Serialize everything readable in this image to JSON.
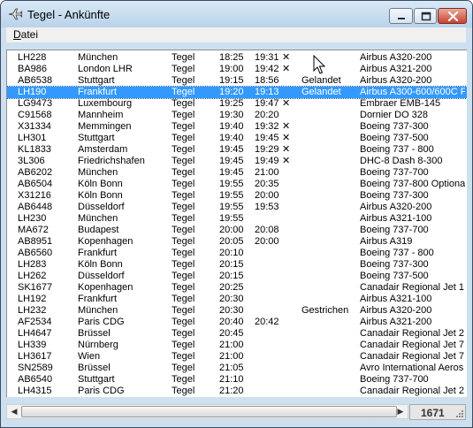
{
  "window": {
    "title": "Tegel - Ankünfte",
    "accent": "#3399ff"
  },
  "menu": {
    "file_prefix": "D",
    "file_rest": "atei"
  },
  "flights": [
    {
      "flight": "LH228",
      "from": "München",
      "airport": "Tegel",
      "scheduled": "18:25",
      "actual": "19:31",
      "mark": "✕",
      "status": "",
      "aircraft": "Airbus A320-200"
    },
    {
      "flight": "BA986",
      "from": "London LHR",
      "airport": "Tegel",
      "scheduled": "19:00",
      "actual": "19:42",
      "mark": "✕",
      "status": "",
      "aircraft": "Airbus A321-200"
    },
    {
      "flight": "AB6538",
      "from": "Stuttgart",
      "airport": "Tegel",
      "scheduled": "19:15",
      "actual": "18:56",
      "mark": "",
      "status": "Gelandet",
      "aircraft": "Airbus A320-200"
    },
    {
      "flight": "LH190",
      "from": "Frankfurt",
      "airport": "Tegel",
      "scheduled": "19:20",
      "actual": "19:13",
      "mark": "",
      "status": "Gelandet",
      "aircraft": "Airbus A300-600/600C F"
    },
    {
      "flight": "LG9473",
      "from": "Luxembourg",
      "airport": "Tegel",
      "scheduled": "19:25",
      "actual": "19:47",
      "mark": "✕",
      "status": "",
      "aircraft": "Embraer EMB-145"
    },
    {
      "flight": "C91568",
      "from": "Mannheim",
      "airport": "Tegel",
      "scheduled": "19:30",
      "actual": "20:20",
      "mark": "",
      "status": "",
      "aircraft": "Dornier DO 328"
    },
    {
      "flight": "X31334",
      "from": "Memmingen",
      "airport": "Tegel",
      "scheduled": "19:40",
      "actual": "19:32",
      "mark": "✕",
      "status": "",
      "aircraft": "Boeing 737-300"
    },
    {
      "flight": "LH301",
      "from": "Stuttgart",
      "airport": "Tegel",
      "scheduled": "19:40",
      "actual": "19:45",
      "mark": "✕",
      "status": "",
      "aircraft": "Boeing 737-500"
    },
    {
      "flight": "KL1833",
      "from": "Amsterdam",
      "airport": "Tegel",
      "scheduled": "19:45",
      "actual": "19:29",
      "mark": "✕",
      "status": "",
      "aircraft": "Boeing 737 - 800"
    },
    {
      "flight": "3L306",
      "from": "Friedrichshafen",
      "airport": "Tegel",
      "scheduled": "19:45",
      "actual": "19:49",
      "mark": "✕",
      "status": "",
      "aircraft": "DHC-8 Dash 8-300"
    },
    {
      "flight": "AB6202",
      "from": "München",
      "airport": "Tegel",
      "scheduled": "19:45",
      "actual": "21:00",
      "mark": "",
      "status": "",
      "aircraft": "Boeing 737-700"
    },
    {
      "flight": "AB6504",
      "from": "Köln Bonn",
      "airport": "Tegel",
      "scheduled": "19:55",
      "actual": "20:35",
      "mark": "",
      "status": "",
      "aircraft": "Boeing 737-800 Optiona"
    },
    {
      "flight": "X31216",
      "from": "Köln Bonn",
      "airport": "Tegel",
      "scheduled": "19:55",
      "actual": "20:00",
      "mark": "",
      "status": "",
      "aircraft": "Boeing 737-300"
    },
    {
      "flight": "AB6448",
      "from": "Düsseldorf",
      "airport": "Tegel",
      "scheduled": "19:55",
      "actual": "19:53",
      "mark": "",
      "status": "",
      "aircraft": "Airbus A320-200"
    },
    {
      "flight": "LH230",
      "from": "München",
      "airport": "Tegel",
      "scheduled": "19:55",
      "actual": "",
      "mark": "",
      "status": "",
      "aircraft": "Airbus A321-100"
    },
    {
      "flight": "MA672",
      "from": "Budapest",
      "airport": "Tegel",
      "scheduled": "20:00",
      "actual": "20:08",
      "mark": "",
      "status": "",
      "aircraft": "Boeing 737-700"
    },
    {
      "flight": "AB8951",
      "from": "Kopenhagen",
      "airport": "Tegel",
      "scheduled": "20:05",
      "actual": "20:00",
      "mark": "",
      "status": "",
      "aircraft": "Airbus A319"
    },
    {
      "flight": "AB6560",
      "from": "Frankfurt",
      "airport": "Tegel",
      "scheduled": "20:10",
      "actual": "",
      "mark": "",
      "status": "",
      "aircraft": "Boeing 737 - 800"
    },
    {
      "flight": "LH283",
      "from": "Köln Bonn",
      "airport": "Tegel",
      "scheduled": "20:15",
      "actual": "",
      "mark": "",
      "status": "",
      "aircraft": "Boeing 737-300"
    },
    {
      "flight": "LH262",
      "from": "Düsseldorf",
      "airport": "Tegel",
      "scheduled": "20:15",
      "actual": "",
      "mark": "",
      "status": "",
      "aircraft": "Boeing 737-500"
    },
    {
      "flight": "SK1677",
      "from": "Kopenhagen",
      "airport": "Tegel",
      "scheduled": "20:25",
      "actual": "",
      "mark": "",
      "status": "",
      "aircraft": "Canadair Regional Jet 1"
    },
    {
      "flight": "LH192",
      "from": "Frankfurt",
      "airport": "Tegel",
      "scheduled": "20:30",
      "actual": "",
      "mark": "",
      "status": "",
      "aircraft": "Airbus A321-100"
    },
    {
      "flight": "LH232",
      "from": "München",
      "airport": "Tegel",
      "scheduled": "20:30",
      "actual": "",
      "mark": "",
      "status": "Gestrichen",
      "aircraft": "Airbus A320-200"
    },
    {
      "flight": "AF2534",
      "from": "Paris CDG",
      "airport": "Tegel",
      "scheduled": "20:40",
      "actual": "20:42",
      "mark": "",
      "status": "",
      "aircraft": "Airbus A321-200"
    },
    {
      "flight": "LH4647",
      "from": "Brüssel",
      "airport": "Tegel",
      "scheduled": "20:45",
      "actual": "",
      "mark": "",
      "status": "",
      "aircraft": "Canadair Regional Jet 2"
    },
    {
      "flight": "LH339",
      "from": "Nürnberg",
      "airport": "Tegel",
      "scheduled": "21:00",
      "actual": "",
      "mark": "",
      "status": "",
      "aircraft": "Canadair Regional Jet 7"
    },
    {
      "flight": "LH3617",
      "from": "Wien",
      "airport": "Tegel",
      "scheduled": "21:00",
      "actual": "",
      "mark": "",
      "status": "",
      "aircraft": "Canadair Regional Jet 7"
    },
    {
      "flight": "SN2589",
      "from": "Brüssel",
      "airport": "Tegel",
      "scheduled": "21:05",
      "actual": "",
      "mark": "",
      "status": "",
      "aircraft": "Avro International Aeros"
    },
    {
      "flight": "AB6540",
      "from": "Stuttgart",
      "airport": "Tegel",
      "scheduled": "21:10",
      "actual": "",
      "mark": "",
      "status": "",
      "aircraft": "Boeing 737-700"
    },
    {
      "flight": "LH4315",
      "from": "Paris CDG",
      "airport": "Tegel",
      "scheduled": "21:20",
      "actual": "",
      "mark": "",
      "status": "",
      "aircraft": "Canadair Regional Jet 2"
    }
  ],
  "selected_row": 3,
  "status": {
    "count": "1671"
  },
  "icons": {
    "app": "airplane-icon",
    "minimize": "minimize-icon",
    "maximize": "maximize-icon",
    "close": "close-icon",
    "scroll_left": "scroll-left-arrow-icon",
    "scroll_right": "scroll-right-arrow-icon",
    "grip": "resize-grip-icon",
    "cursor": "mouse-cursor-icon"
  }
}
